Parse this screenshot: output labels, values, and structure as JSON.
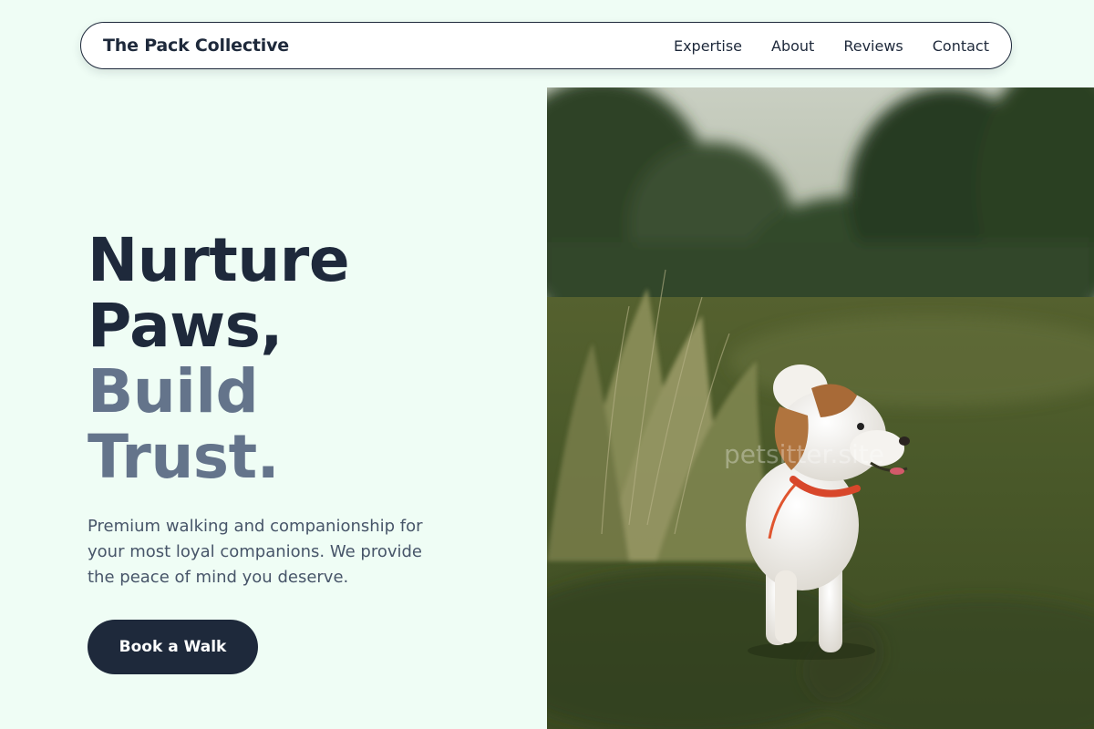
{
  "nav": {
    "brand": "The Pack Collective",
    "links": [
      "Expertise",
      "About",
      "Reviews",
      "Contact"
    ]
  },
  "hero": {
    "title_lines": [
      "Nurture",
      "Paws,",
      "Build",
      "Trust."
    ],
    "subtitle": "Premium walking and companionship for your most loyal companions. We provide the peace of mind you deserve.",
    "cta_label": "Book a Walk",
    "image_watermark": "petsitter.site"
  },
  "colors": {
    "background": "#effdf5",
    "primary_dark": "#1e293b",
    "muted": "#64748b",
    "body_text": "#475569"
  }
}
